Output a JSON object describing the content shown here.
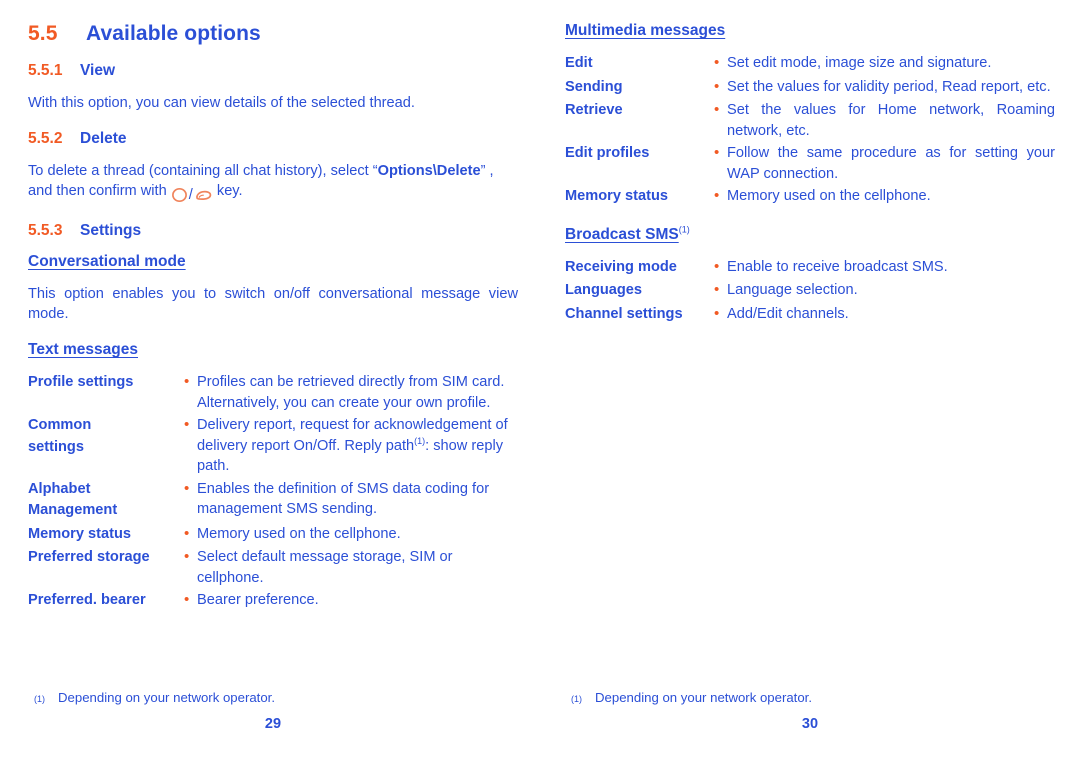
{
  "colors": {
    "heading_orange": "#F15A24",
    "body_blue": "#2B4FD6",
    "key_glyph": "#F0845C"
  },
  "left_page": {
    "section": {
      "number": "5.5",
      "title": "Available options"
    },
    "sub_view": {
      "number": "5.5.1",
      "title": "View"
    },
    "view_paragraph": "With this option, you can view details of the selected thread.",
    "sub_delete": {
      "number": "5.5.2",
      "title": "Delete"
    },
    "delete_paragraph": {
      "part1": "To delete a thread (containing all chat history), select “",
      "bold": "Options\\Delete",
      "part2": "” , and then confirm with ",
      "part3": " key."
    },
    "sub_settings": {
      "number": "5.5.3",
      "title": "Settings"
    },
    "conversational_mode": {
      "heading": "Conversational mode",
      "paragraph": "This option enables you to switch on/off conversational message view mode."
    },
    "text_messages": {
      "heading": "Text messages",
      "rows": [
        {
          "term": "Profile settings",
          "lines": [
            "Profiles can be retrieved directly from SIM card.",
            "Alternatively, you can create your own profile."
          ]
        },
        {
          "term": "Common settings",
          "lines": [
            "Delivery report, request for acknowledgement of",
            "delivery report On/Off. Reply path⁽¹⁾: show reply",
            "path."
          ],
          "has_footnote": true,
          "footnote_before": "delivery report On/Off. Reply path",
          "footnote_mark": "(1)",
          "footnote_after": ": show reply"
        },
        {
          "term": "Alphabet Management",
          "lines": [
            "Enables the definition of SMS data coding for",
            "management SMS sending."
          ]
        },
        {
          "term": "Memory status",
          "lines": [
            "Memory used on the cellphone."
          ]
        },
        {
          "term": "Preferred storage",
          "lines": [
            "Select default message storage, SIM or cellphone."
          ]
        },
        {
          "term": "Preferred. bearer",
          "lines": [
            "Bearer preference."
          ]
        }
      ]
    },
    "footnote": {
      "mark": "(1)",
      "text": "Depending on your network operator."
    },
    "page_number": "29"
  },
  "right_page": {
    "multimedia_messages": {
      "heading": "Multimedia messages",
      "rows": [
        {
          "term": "Edit",
          "lines": [
            "Set edit mode, image size and signature."
          ]
        },
        {
          "term": "Sending",
          "lines": [
            "Set the values for validity period, Read report, etc."
          ]
        },
        {
          "term": "Retrieve",
          "lines": [
            "Set the values for Home network, Roaming",
            "network, etc."
          ],
          "justify": true
        },
        {
          "term": "Edit profiles",
          "lines": [
            "Follow the same procedure as for setting your",
            "WAP connection."
          ],
          "justify": true
        },
        {
          "term": "Memory status",
          "lines": [
            "Memory used on the cellphone."
          ]
        }
      ]
    },
    "broadcast_sms": {
      "heading": "Broadcast SMS",
      "footnote_mark": "(1)",
      "rows": [
        {
          "term": "Receiving mode",
          "lines": [
            "Enable to receive broadcast SMS."
          ]
        },
        {
          "term": "Languages",
          "lines": [
            "Language selection."
          ]
        },
        {
          "term": "Channel settings",
          "lines": [
            "Add/Edit channels."
          ]
        }
      ]
    },
    "footnote": {
      "mark": "(1)",
      "text": "Depending on your network operator."
    },
    "page_number": "30"
  }
}
